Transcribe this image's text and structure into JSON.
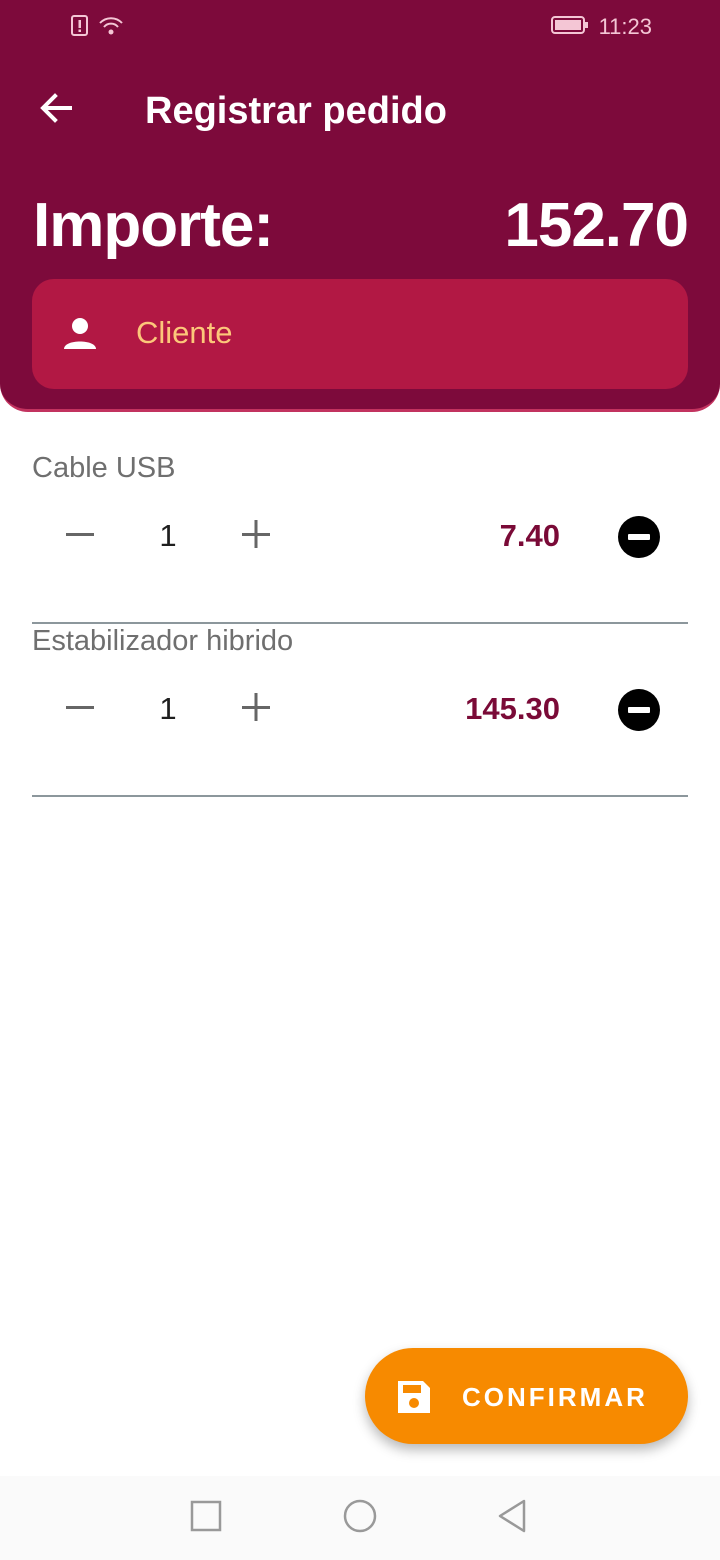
{
  "status_bar": {
    "time": "11:23",
    "icons": [
      "sim-alert-icon",
      "wifi-icon",
      "battery-icon"
    ]
  },
  "header": {
    "back_icon": "arrow-left-icon",
    "title": "Registrar pedido",
    "importe_label": "Importe:",
    "importe_value": "152.70",
    "cliente_icon": "person-icon",
    "cliente_label": "Cliente"
  },
  "items": [
    {
      "name": "Cable USB",
      "quantity": "1",
      "price": "7.40"
    },
    {
      "name": "Estabilizador hibrido",
      "quantity": "1",
      "price": "145.30"
    }
  ],
  "fab": {
    "icon": "save-icon",
    "label": "CONFIRMAR"
  },
  "navbar": {
    "icons": [
      "recent-apps-icon",
      "home-icon",
      "back-triangle-icon"
    ]
  },
  "colors": {
    "header_bg": "#7d0a3b",
    "cliente_bg": "#b21844",
    "cliente_text": "#fcc77a",
    "price_text": "#7a0a37",
    "fab_bg": "#f78a00"
  }
}
